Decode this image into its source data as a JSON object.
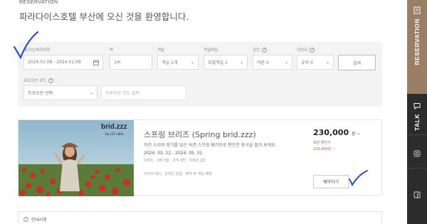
{
  "header": {
    "eyebrow": "RESERVATION",
    "title": "파라다이스호텔 부산에 오신 것을 환영합니다."
  },
  "filters": {
    "dates": {
      "label": "체크인/체크아웃",
      "value": "2024.01.08 - 2024.01.09"
    },
    "nights": {
      "label": "박",
      "value": "1박"
    },
    "rooms": {
      "label": "객실",
      "value": "객실 1개"
    },
    "room_type": {
      "label": "객실타입",
      "value": "호텔객실 1"
    },
    "adults": {
      "label": "성인",
      "value": "어른 0"
    },
    "children": {
      "label": "어린이",
      "value": "유아 0"
    },
    "search_button": "검색",
    "promo": {
      "label": "프로모션 코드",
      "value": "프로모션 선택",
      "placeholder": "프로모션 코드 입력"
    }
  },
  "offer": {
    "brand": "brid.zzz",
    "brand_sub": "by LG Labs",
    "title": "스프링 브리즈 (Spring brid.zzz)",
    "description": "자연 소리와 향기를 담은 숙면 스프링 패키지로 편안한 휴식을 즐겨 보세요.",
    "date_range": "2024. 03. 22 - 2024. 05. 31",
    "tags": "디럭스 · 1박 2일 · 조식 2인 · 디럭스 2인",
    "note": "이미지 예시 · 온라인 전용 · 예약 후 객실 배정",
    "price": "230,000",
    "price_unit": "원 ~",
    "price_label": "회원 할인가",
    "price_member": "225,400원 ~",
    "book_button": "예약하기"
  },
  "notice": {
    "title": "안내사항"
  },
  "sidebar": {
    "reservation": "RESERVATION",
    "talk": "TALK"
  },
  "colors": {
    "accent": "#9a7e65",
    "sidebar": "#2c2c2c",
    "check": "#2b4fc7"
  }
}
